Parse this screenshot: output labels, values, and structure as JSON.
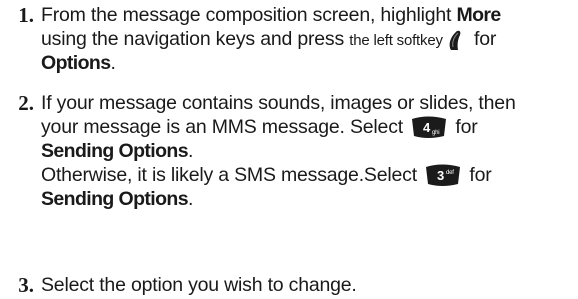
{
  "steps": [
    {
      "number": "1.",
      "line1_before": "From the message composition screen, highlight ",
      "line1_bold": "More",
      "line2_before": "using the navigation keys and press ",
      "line2_small": "the left softkey",
      "line2_after": " for",
      "line3_bold": "Options",
      "line3_after": "."
    },
    {
      "number": "2.",
      "line1": "If your message contains sounds, images or slides, then",
      "line2_before": "your message is an MMS message. Select ",
      "line2_after": " for",
      "line3_bold": "Sending Options",
      "line3_after": ".",
      "line4_before": "Otherwise, it is likely a SMS message.Select ",
      "line4_after": " for",
      "line5_bold": "Sending Options",
      "line5_after": "."
    },
    {
      "number": "3.",
      "text": "Select the option you wish to change."
    }
  ],
  "icons": {
    "left_softkey": "left-softkey-icon",
    "key_4": "key-4-ghi-icon",
    "key_3": "key-3-def-icon"
  },
  "keys": {
    "key4_digit": "4",
    "key4_letters": "ghi",
    "key3_digit": "3",
    "key3_letters": "def"
  },
  "colors": {
    "key_fill": "#1b1b1b",
    "text": "#1a1a1a"
  }
}
